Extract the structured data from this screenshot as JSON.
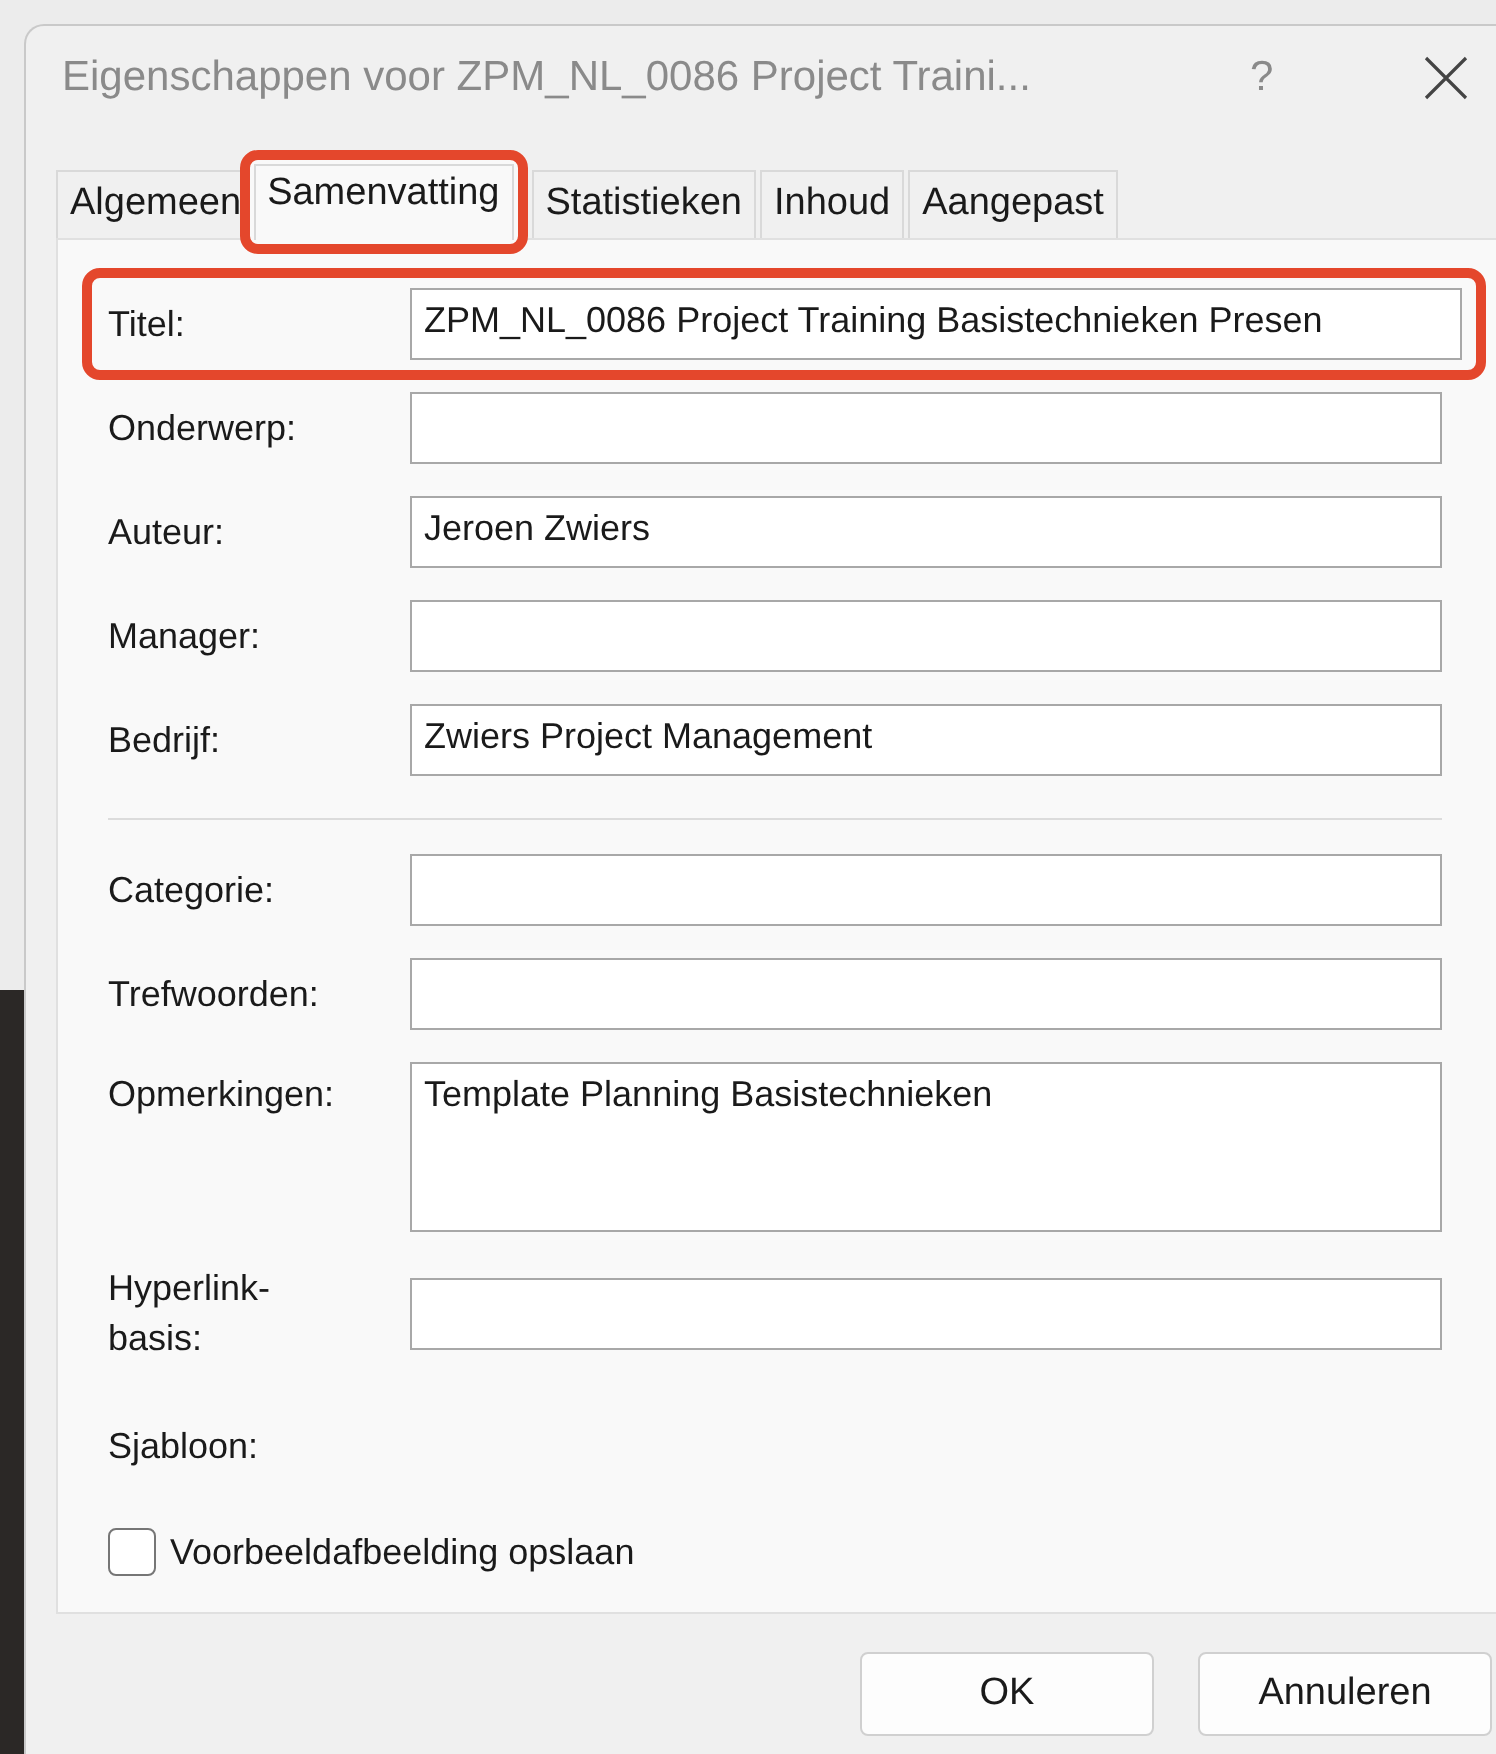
{
  "window": {
    "title": "Eigenschappen voor ZPM_NL_0086 Project Traini...",
    "help": "?"
  },
  "tabs": [
    {
      "label": "Algemeen",
      "selected": false,
      "highlighted": false
    },
    {
      "label": "Samenvatting",
      "selected": true,
      "highlighted": true
    },
    {
      "label": "Statistieken",
      "selected": false,
      "highlighted": false
    },
    {
      "label": "Inhoud",
      "selected": false,
      "highlighted": false
    },
    {
      "label": "Aangepast",
      "selected": false,
      "highlighted": false
    }
  ],
  "sections": [
    {
      "fields": [
        {
          "kind": "line",
          "label": "Titel:",
          "value": "ZPM_NL_0086 Project Training Basistechnieken Presen",
          "highlighted": true
        },
        {
          "kind": "line",
          "label": "Onderwerp:",
          "highlighted": false
        },
        {
          "kind": "line",
          "label": "Auteur:",
          "value": "Jeroen Zwiers",
          "highlighted": false
        },
        {
          "kind": "line",
          "label": "Manager:",
          "highlighted": false
        },
        {
          "kind": "line",
          "label": "Bedrijf:",
          "value": "Zwiers Project Management",
          "highlighted": false
        }
      ]
    },
    {
      "fields": [
        {
          "kind": "line",
          "label": "Categorie:",
          "highlighted": false
        },
        {
          "kind": "line",
          "label": "Trefwoorden:",
          "highlighted": false
        },
        {
          "kind": "multiline",
          "label": "Opmerkingen:",
          "value": "Template Planning Basistechnieken",
          "highlighted": false
        },
        {
          "kind": "line",
          "label": "Hyperlink-basis:",
          "highlighted": false
        },
        {
          "kind": "text",
          "label": "Sjabloon:",
          "highlighted": false
        }
      ]
    }
  ],
  "checkbox": {
    "label": "Voorbeeldafbeelding opslaan",
    "checked": false
  },
  "buttons": [
    "OK",
    "Annuleren"
  ]
}
